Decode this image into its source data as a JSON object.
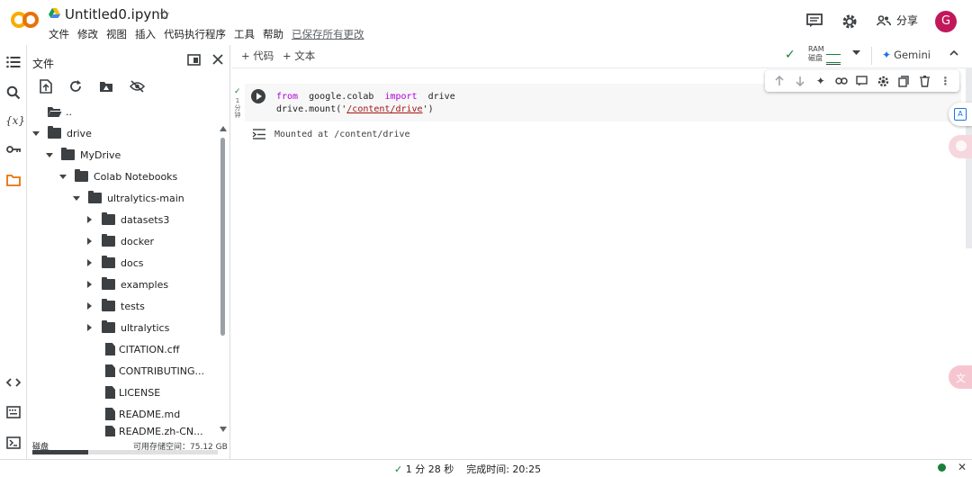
{
  "header": {
    "title": "Untitled0.ipynb",
    "menu": [
      "文件",
      "修改",
      "视图",
      "插入",
      "代码执行程序",
      "工具",
      "帮助"
    ],
    "saved_status": "已保存所有更改",
    "share_label": "分享",
    "avatar_letter": "G"
  },
  "colors": {
    "logo_orange": "#f9ab00",
    "accent_green": "#188038",
    "avatar": "#c2185b"
  },
  "file_panel": {
    "title": "文件",
    "items": [
      {
        "label": "..",
        "type": "folder-up"
      },
      {
        "label": "drive",
        "type": "folder",
        "expanded": true
      },
      {
        "label": "MyDrive",
        "type": "folder",
        "expanded": true
      },
      {
        "label": "Colab Notebooks",
        "type": "folder",
        "expanded": true
      },
      {
        "label": "ultralytics-main",
        "type": "folder",
        "expanded": true
      },
      {
        "label": "datasets3",
        "type": "folder",
        "expanded": false
      },
      {
        "label": "docker",
        "type": "folder",
        "expanded": false
      },
      {
        "label": "docs",
        "type": "folder",
        "expanded": false
      },
      {
        "label": "examples",
        "type": "folder",
        "expanded": false
      },
      {
        "label": "tests",
        "type": "folder",
        "expanded": false
      },
      {
        "label": "ultralytics",
        "type": "folder",
        "expanded": false
      },
      {
        "label": "CITATION.cff",
        "type": "file"
      },
      {
        "label": "CONTRIBUTING...",
        "type": "file"
      },
      {
        "label": "LICENSE",
        "type": "file"
      },
      {
        "label": "README.md",
        "type": "file"
      },
      {
        "label": "README.zh-CN...",
        "type": "file"
      }
    ],
    "disk_label": "磁盘",
    "disk_space": "可用存储空间：75.12 GB",
    "disk_used_fraction": 0.3
  },
  "toolbar": {
    "add_code": "+ 代码",
    "add_text": "+ 文本",
    "ram_label": "RAM",
    "disk_label": "磁盘",
    "gemini_label": "Gemini"
  },
  "cell": {
    "exec_time": "1 分钟",
    "code_line1_kw1": "from",
    "code_line1_mod": "google.colab",
    "code_line1_kw2": "import",
    "code_line1_name": "drive",
    "code_line2_pre": "drive.mount('",
    "code_line2_str": "/content/drive",
    "code_line2_post": "')",
    "output": "Mounted at /content/drive"
  },
  "status": {
    "duration": "1 分 28 秒",
    "completed": "完成时间:  20:25"
  }
}
